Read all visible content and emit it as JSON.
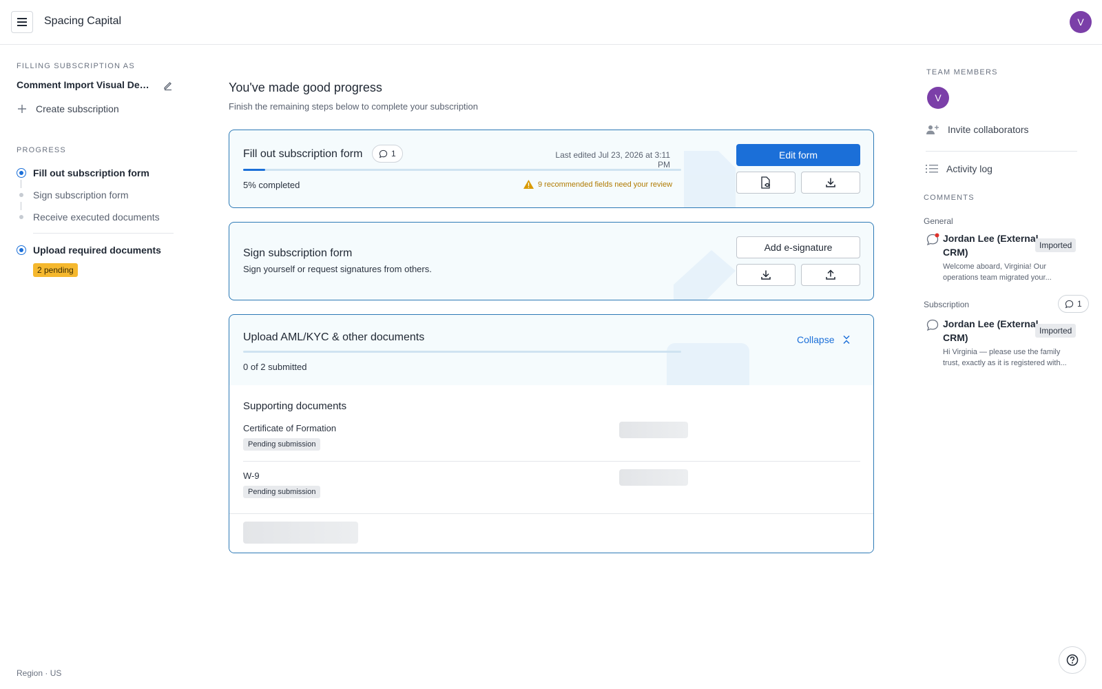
{
  "app": {
    "title": "Spacing Capital",
    "avatar_initial": "V"
  },
  "left": {
    "filling_label": "FILLING SUBSCRIPTION AS",
    "entity_name": "Comment Import Visual Demo",
    "create_label": "Create subscription",
    "progress_label": "PROGRESS",
    "steps": [
      {
        "label": "Fill out subscription form",
        "state": "active"
      },
      {
        "label": "Sign subscription form",
        "state": "pending"
      },
      {
        "label": "Receive executed documents",
        "state": "pending"
      },
      {
        "label": "Upload required documents",
        "state": "active"
      }
    ],
    "pending_badge": "2 pending",
    "region": "Region · US"
  },
  "main": {
    "title": "You've made good progress",
    "subtitle": "Finish the remaining steps below to complete your subscription",
    "fill_card": {
      "title": "Fill out subscription form",
      "comment_count": "1",
      "last_edited": "Last edited Jul 23, 2026 at 3:11 PM",
      "progress_fraction": 0.05,
      "completed_text": "5% completed",
      "warning": "9 recommended fields need your review",
      "edit_button": "Edit form"
    },
    "sign_card": {
      "title": "Sign subscription form",
      "subtitle": "Sign yourself or request signatures from others.",
      "esign_button": "Add e-signature"
    },
    "upload_card": {
      "title": "Upload AML/KYC & other documents",
      "submitted_text": "0 of 2 submitted",
      "progress_fraction": 0,
      "collapse_label": "Collapse",
      "supporting_title": "Supporting documents",
      "documents": [
        {
          "name": "Certificate of Formation",
          "status": "Pending submission"
        },
        {
          "name": "W-9",
          "status": "Pending submission"
        }
      ]
    }
  },
  "right": {
    "team_label": "TEAM MEMBERS",
    "member_initial": "V",
    "invite_label": "Invite collaborators",
    "activity_label": "Activity log",
    "comments_label": "COMMENTS",
    "groups": [
      {
        "name": "General",
        "comment": {
          "author": "Jordan Lee (External CRM)",
          "tag": "Imported",
          "body_line1": "Welcome aboard, Virginia! Our",
          "body_line2": "operations team migrated your...",
          "unread": true
        }
      },
      {
        "name": "Subscription",
        "count": "1",
        "comment": {
          "author": "Jordan Lee (External CRM)",
          "tag": "Imported",
          "body_line1": "Hi Virginia — please use the family",
          "body_line2": "trust, exactly as it is registered with...",
          "unread": false
        }
      }
    ]
  },
  "colors": {
    "accent": "#1b6fd8",
    "avatar": "#7b3fa8",
    "badge": "#f5b82e",
    "warning": "#b07a00"
  }
}
